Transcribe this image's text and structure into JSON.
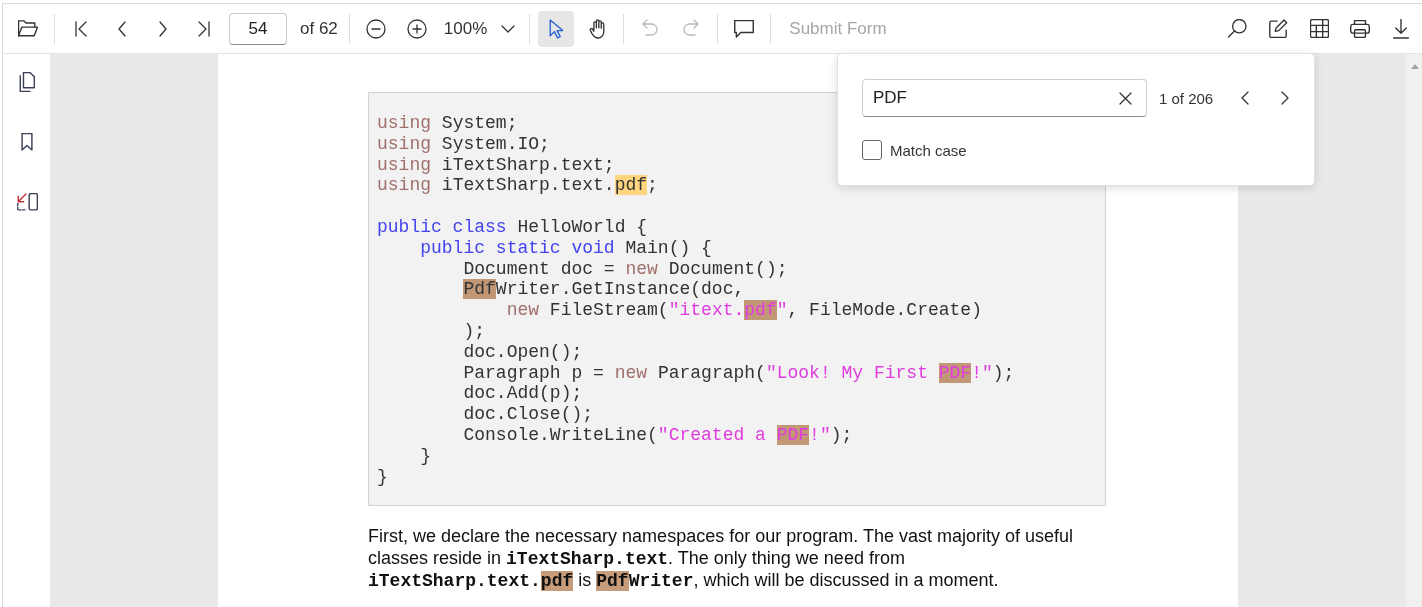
{
  "toolbar": {
    "page_number": "54",
    "page_count": "of 62",
    "zoom": "100%",
    "tools": [
      {
        "kind": "select",
        "selected": true
      },
      {
        "kind": "pan",
        "selected": false
      }
    ],
    "history": [
      {
        "kind": "undo",
        "disabled": true
      },
      {
        "kind": "redo",
        "disabled": true
      }
    ],
    "submit_form": {
      "label": "Submit Form",
      "disabled": true
    }
  },
  "search": {
    "query": "PDF",
    "count": "1 of 206",
    "match_case": {
      "label": "Match case",
      "checked": false
    }
  },
  "document": {
    "code_blocks": [
      [
        [
          {
            "text": "using",
            "kind": "keyword",
            "match": false
          },
          {
            "text": " System;",
            "kind": "plain",
            "match": false
          }
        ],
        [
          {
            "text": "using",
            "kind": "keyword",
            "match": false
          },
          {
            "text": " System.IO;",
            "kind": "plain",
            "match": false
          }
        ],
        [
          {
            "text": "using",
            "kind": "keyword",
            "match": false
          },
          {
            "text": " iTextSharp.text;",
            "kind": "plain",
            "match": false
          }
        ],
        [
          {
            "text": "using",
            "kind": "keyword",
            "match": false
          },
          {
            "text": " iTextSharp.text.",
            "kind": "plain",
            "match": false
          },
          {
            "text": "pdf",
            "kind": "plain",
            "match": true,
            "current": true
          },
          {
            "text": ";",
            "kind": "plain",
            "match": false
          }
        ]
      ],
      [
        [
          {
            "text": "public class",
            "kind": "modifier",
            "match": false
          },
          {
            "text": " HelloWorld {",
            "kind": "plain",
            "match": false
          }
        ],
        [
          {
            "text": "    public static void",
            "kind": "modifier",
            "match": false
          },
          {
            "text": " Main() {",
            "kind": "plain",
            "match": false
          }
        ],
        [
          {
            "text": "        Document doc = ",
            "kind": "plain",
            "match": false
          },
          {
            "text": "new",
            "kind": "keyword",
            "match": false
          },
          {
            "text": " Document();",
            "kind": "plain",
            "match": false
          }
        ],
        [
          {
            "text": "        Pdf",
            "kind": "plain",
            "match": true,
            "current": false
          },
          {
            "text": "Writer.GetInstance(doc,",
            "kind": "plain",
            "match": false
          }
        ],
        [
          {
            "text": "            new",
            "kind": "keyword",
            "match": false
          },
          {
            "text": " FileStream(",
            "kind": "plain",
            "match": false
          },
          {
            "text": "\"itext.",
            "kind": "string",
            "match": false
          },
          {
            "text": "pdf",
            "kind": "string",
            "match": true,
            "current": false
          },
          {
            "text": "\"",
            "kind": "string",
            "match": false
          },
          {
            "text": ", FileMode.Create)",
            "kind": "plain",
            "match": false
          }
        ],
        [
          {
            "text": "        );",
            "kind": "plain",
            "match": false
          }
        ],
        [
          {
            "text": "        doc.Open();",
            "kind": "plain",
            "match": false
          }
        ],
        [
          {
            "text": "        Paragraph p = ",
            "kind": "plain",
            "match": false
          },
          {
            "text": "new",
            "kind": "keyword",
            "match": false
          },
          {
            "text": " Paragraph(",
            "kind": "plain",
            "match": false
          },
          {
            "text": "\"Look! My First ",
            "kind": "string",
            "match": false
          },
          {
            "text": "PDF",
            "kind": "string",
            "match": true,
            "current": false
          },
          {
            "text": "!\"",
            "kind": "string",
            "match": false
          },
          {
            "text": ");",
            "kind": "plain",
            "match": false
          }
        ],
        [
          {
            "text": "        doc.Add(p);",
            "kind": "plain",
            "match": false
          }
        ],
        [
          {
            "text": "        doc.Close();",
            "kind": "plain",
            "match": false
          }
        ],
        [
          {
            "text": "        Console.WriteLine(",
            "kind": "plain",
            "match": false
          },
          {
            "text": "\"Created a ",
            "kind": "string",
            "match": false
          },
          {
            "text": "PDF",
            "kind": "string",
            "match": true,
            "current": false
          },
          {
            "text": "!\"",
            "kind": "string",
            "match": false
          },
          {
            "text": ");",
            "kind": "plain",
            "match": false
          }
        ],
        [
          {
            "text": "    }",
            "kind": "plain",
            "match": false
          }
        ],
        [
          {
            "text": "}",
            "kind": "plain",
            "match": false
          }
        ]
      ]
    ],
    "paragraph": [
      {
        "text": "First, we declare the necessary namespaces for our program. The vast majority of useful classes reside in ",
        "kind": "text",
        "match": false
      },
      {
        "text": "iTextSharp.text",
        "kind": "code",
        "match": false
      },
      {
        "text": ". The only thing we need from ",
        "kind": "text",
        "match": false
      },
      {
        "text": "iTextSharp.text.",
        "kind": "code",
        "match": false
      },
      {
        "text": "pdf",
        "kind": "code",
        "match": true,
        "current": false
      },
      {
        "text": " is ",
        "kind": "text",
        "match": false
      },
      {
        "text": "Pdf",
        "kind": "code",
        "match": true,
        "current": false
      },
      {
        "text": "Writer",
        "kind": "code",
        "match": false
      },
      {
        "text": ", which will be discussed in a moment.",
        "kind": "text",
        "match": false
      }
    ]
  }
}
